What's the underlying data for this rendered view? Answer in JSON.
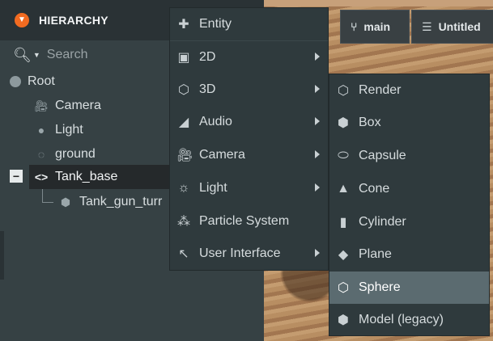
{
  "hierarchy": {
    "title": "HIERARCHY",
    "search_placeholder": "Search",
    "nodes": [
      {
        "label": "Root",
        "icon": "root-dot-icon"
      },
      {
        "label": "Camera",
        "icon": "camera-icon"
      },
      {
        "label": "Light",
        "icon": "light-bulb-icon"
      },
      {
        "label": "ground",
        "icon": "entity-icon"
      },
      {
        "label": "Tank_base",
        "icon": "code-brackets-icon"
      },
      {
        "label": "Tank_gun_turr",
        "icon": "cube-icon"
      }
    ]
  },
  "toolbar": {
    "branch_label": "main",
    "scene_label": "Untitled"
  },
  "context_menu": {
    "items": [
      {
        "label": "Entity",
        "icon": "plus-icon",
        "submenu": false
      },
      {
        "label": "2D",
        "icon": "image-icon",
        "submenu": true
      },
      {
        "label": "3D",
        "icon": "hexagon-icon",
        "submenu": true
      },
      {
        "label": "Audio",
        "icon": "audio-icon",
        "submenu": true
      },
      {
        "label": "Camera",
        "icon": "camera-icon",
        "submenu": true
      },
      {
        "label": "Light",
        "icon": "light-icon",
        "submenu": true
      },
      {
        "label": "Particle System",
        "icon": "particles-icon",
        "submenu": false
      },
      {
        "label": "User Interface",
        "icon": "cursor-icon",
        "submenu": true
      }
    ]
  },
  "submenu_3d": {
    "items": [
      {
        "label": "Render",
        "icon": "render-icon"
      },
      {
        "label": "Box",
        "icon": "box-icon"
      },
      {
        "label": "Capsule",
        "icon": "capsule-icon"
      },
      {
        "label": "Cone",
        "icon": "cone-icon"
      },
      {
        "label": "Cylinder",
        "icon": "cylinder-icon"
      },
      {
        "label": "Plane",
        "icon": "plane-icon"
      },
      {
        "label": "Sphere",
        "icon": "sphere-icon",
        "highlighted": true
      },
      {
        "label": "Model (legacy)",
        "icon": "model-icon"
      }
    ]
  },
  "colors": {
    "accent": "#f26b21",
    "highlight": "#5b6b70",
    "panel": "#364144"
  }
}
